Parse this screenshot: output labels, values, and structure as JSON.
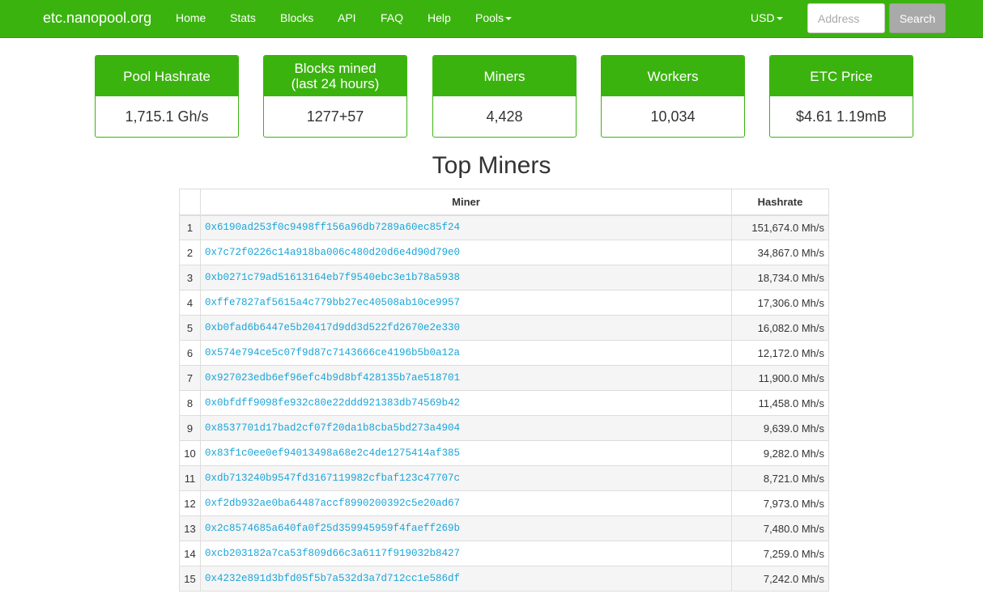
{
  "nav": {
    "brand": "etc.nanopool.org",
    "items": [
      "Home",
      "Stats",
      "Blocks",
      "API",
      "FAQ",
      "Help",
      "Pools"
    ],
    "currency": "USD",
    "address_placeholder": "Address",
    "search_label": "Search"
  },
  "stats": [
    {
      "label": "Pool Hashrate",
      "value": "1,715.1 Gh/s"
    },
    {
      "label": "Blocks mined\n(last 24 hours)",
      "value": "1277+57"
    },
    {
      "label": "Miners",
      "value": "4,428"
    },
    {
      "label": "Workers",
      "value": "10,034"
    },
    {
      "label": "ETC Price",
      "value": "$4.61 1.19mB"
    }
  ],
  "top_miners": {
    "title": "Top Miners",
    "columns": [
      "",
      "Miner",
      "Hashrate"
    ],
    "rows": [
      {
        "rank": "1",
        "address": "0x6190ad253f0c9498ff156a96db7289a60ec85f24",
        "hashrate": "151,674.0 Mh/s"
      },
      {
        "rank": "2",
        "address": "0x7c72f0226c14a918ba006c480d20d6e4d90d79e0",
        "hashrate": "34,867.0 Mh/s"
      },
      {
        "rank": "3",
        "address": "0xb0271c79ad51613164eb7f9540ebc3e1b78a5938",
        "hashrate": "18,734.0 Mh/s"
      },
      {
        "rank": "4",
        "address": "0xffe7827af5615a4c779bb27ec40508ab10ce9957",
        "hashrate": "17,306.0 Mh/s"
      },
      {
        "rank": "5",
        "address": "0xb0fad6b6447e5b20417d9dd3d522fd2670e2e330",
        "hashrate": "16,082.0 Mh/s"
      },
      {
        "rank": "6",
        "address": "0x574e794ce5c07f9d87c7143666ce4196b5b0a12a",
        "hashrate": "12,172.0 Mh/s"
      },
      {
        "rank": "7",
        "address": "0x927023edb6ef96efc4b9d8bf428135b7ae518701",
        "hashrate": "11,900.0 Mh/s"
      },
      {
        "rank": "8",
        "address": "0x0bfdff9098fe932c80e22ddd921383db74569b42",
        "hashrate": "11,458.0 Mh/s"
      },
      {
        "rank": "9",
        "address": "0x8537701d17bad2cf07f20da1b8cba5bd273a4904",
        "hashrate": "9,639.0 Mh/s"
      },
      {
        "rank": "10",
        "address": "0x83f1c0ee0ef94013498a68e2c4de1275414af385",
        "hashrate": "9,282.0 Mh/s"
      },
      {
        "rank": "11",
        "address": "0xdb713240b9547fd3167119982cfbaf123c47707c",
        "hashrate": "8,721.0 Mh/s"
      },
      {
        "rank": "12",
        "address": "0xf2db932ae0ba64487accf8990200392c5e20ad67",
        "hashrate": "7,973.0 Mh/s"
      },
      {
        "rank": "13",
        "address": "0x2c8574685a640fa0f25d359945959f4faeff269b",
        "hashrate": "7,480.0 Mh/s"
      },
      {
        "rank": "14",
        "address": "0xcb203182a7ca53f809d66c3a6117f919032b8427",
        "hashrate": "7,259.0 Mh/s"
      },
      {
        "rank": "15",
        "address": "0x4232e891d3bfd05f5b7a532d3a7d712cc1e586df",
        "hashrate": "7,242.0 Mh/s"
      }
    ]
  },
  "colors": {
    "brand_green": "#3bb30f",
    "link_blue": "#1aa5d8",
    "search_gray": "#a9a9a9"
  }
}
